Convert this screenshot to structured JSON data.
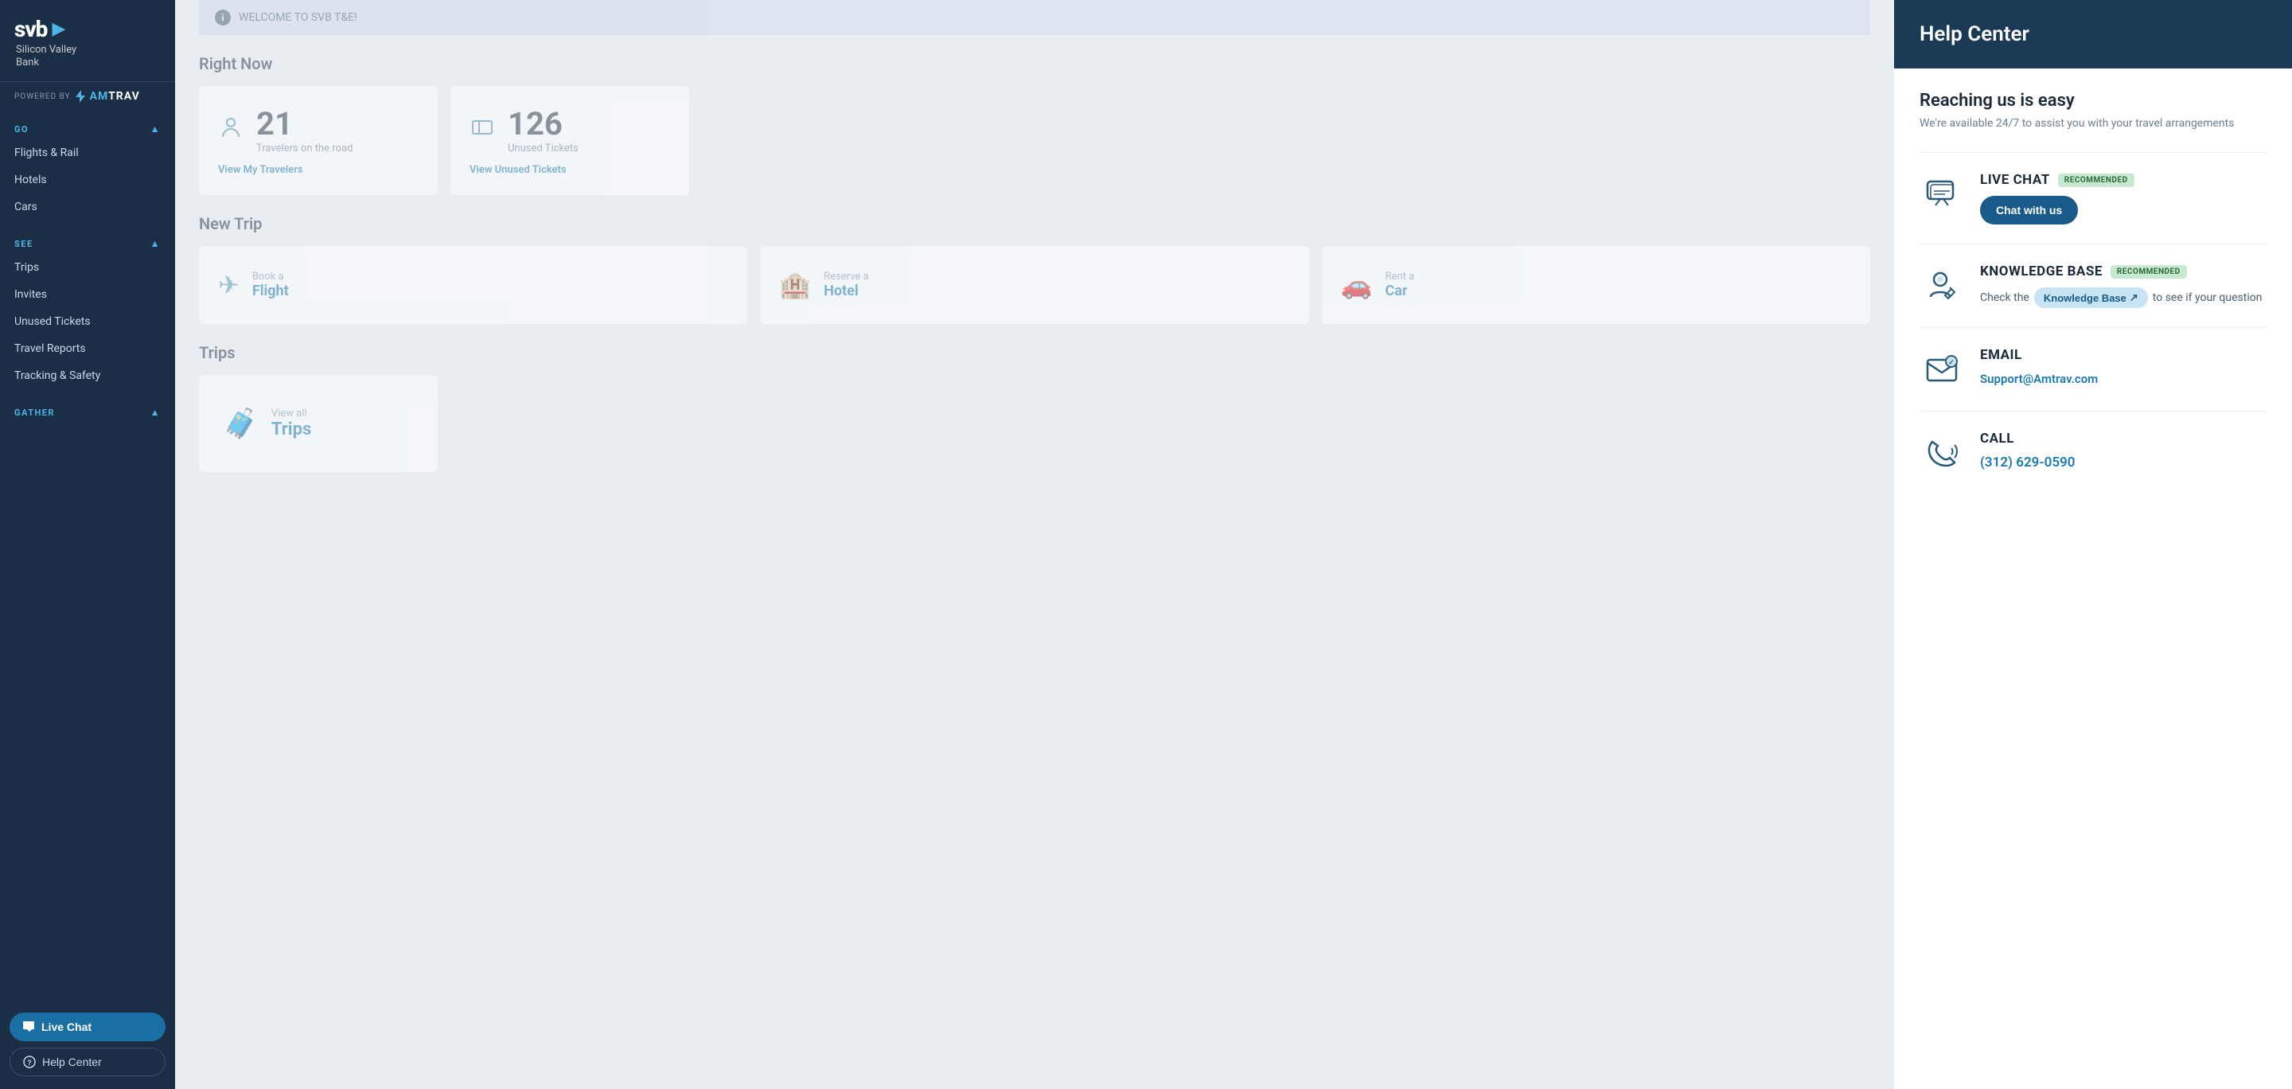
{
  "sidebar": {
    "logo": {
      "text": "svb",
      "arrow": "▶",
      "subtitle": "Silicon Valley\nBank"
    },
    "powered_by": "POWERED BY",
    "amtrav": "AmTrav",
    "sections": [
      {
        "label": "GO",
        "items": [
          "Flights & Rail",
          "Hotels",
          "Cars"
        ]
      },
      {
        "label": "SEE",
        "items": [
          "Trips",
          "Invites",
          "Unused Tickets",
          "Travel Reports",
          "Tracking & Safety"
        ]
      },
      {
        "label": "GATHER",
        "items": []
      }
    ],
    "live_chat_btn": "Live Chat",
    "help_center_btn": "Help Center"
  },
  "welcome_bar": {
    "text": "WELCOME TO SVB T&E!"
  },
  "right_now": {
    "title": "Right Now",
    "stat1": {
      "number": "21",
      "label": "Travelers on the road",
      "link": "View My Travelers"
    },
    "stat2": {
      "number": "126",
      "label": "Unused Tickets",
      "link": "View Unused Tickets"
    }
  },
  "new_trip": {
    "title": "New Trip",
    "cards": [
      {
        "sub": "Book a",
        "main": "Flight"
      },
      {
        "sub": "Reserve a",
        "main": "Hotel"
      },
      {
        "sub": "Rent a",
        "main": "Car"
      }
    ]
  },
  "trips": {
    "title": "Trips",
    "view_all_sub": "View all",
    "view_all_main": "Trips"
  },
  "help_center": {
    "title": "Help Center",
    "reaching_title": "Reaching us is easy",
    "reaching_sub": "We're available 24/7 to assist you with your travel arrangements",
    "options": [
      {
        "id": "live-chat",
        "name": "LIVE CHAT",
        "badge": "RECOMMENDED",
        "cta_label": "Chat with us",
        "description": null
      },
      {
        "id": "knowledge-base",
        "name": "KNOWLEDGE BASE",
        "badge": "RECOMMENDED",
        "cta_label": "Knowledge Base",
        "description_prefix": "Check the",
        "description_suffix": "to see if your question"
      },
      {
        "id": "email",
        "name": "EMAIL",
        "badge": null,
        "email": "Support@Amtrav.com"
      },
      {
        "id": "call",
        "name": "CALL",
        "badge": null,
        "phone": "(312) 629-0590"
      }
    ]
  }
}
